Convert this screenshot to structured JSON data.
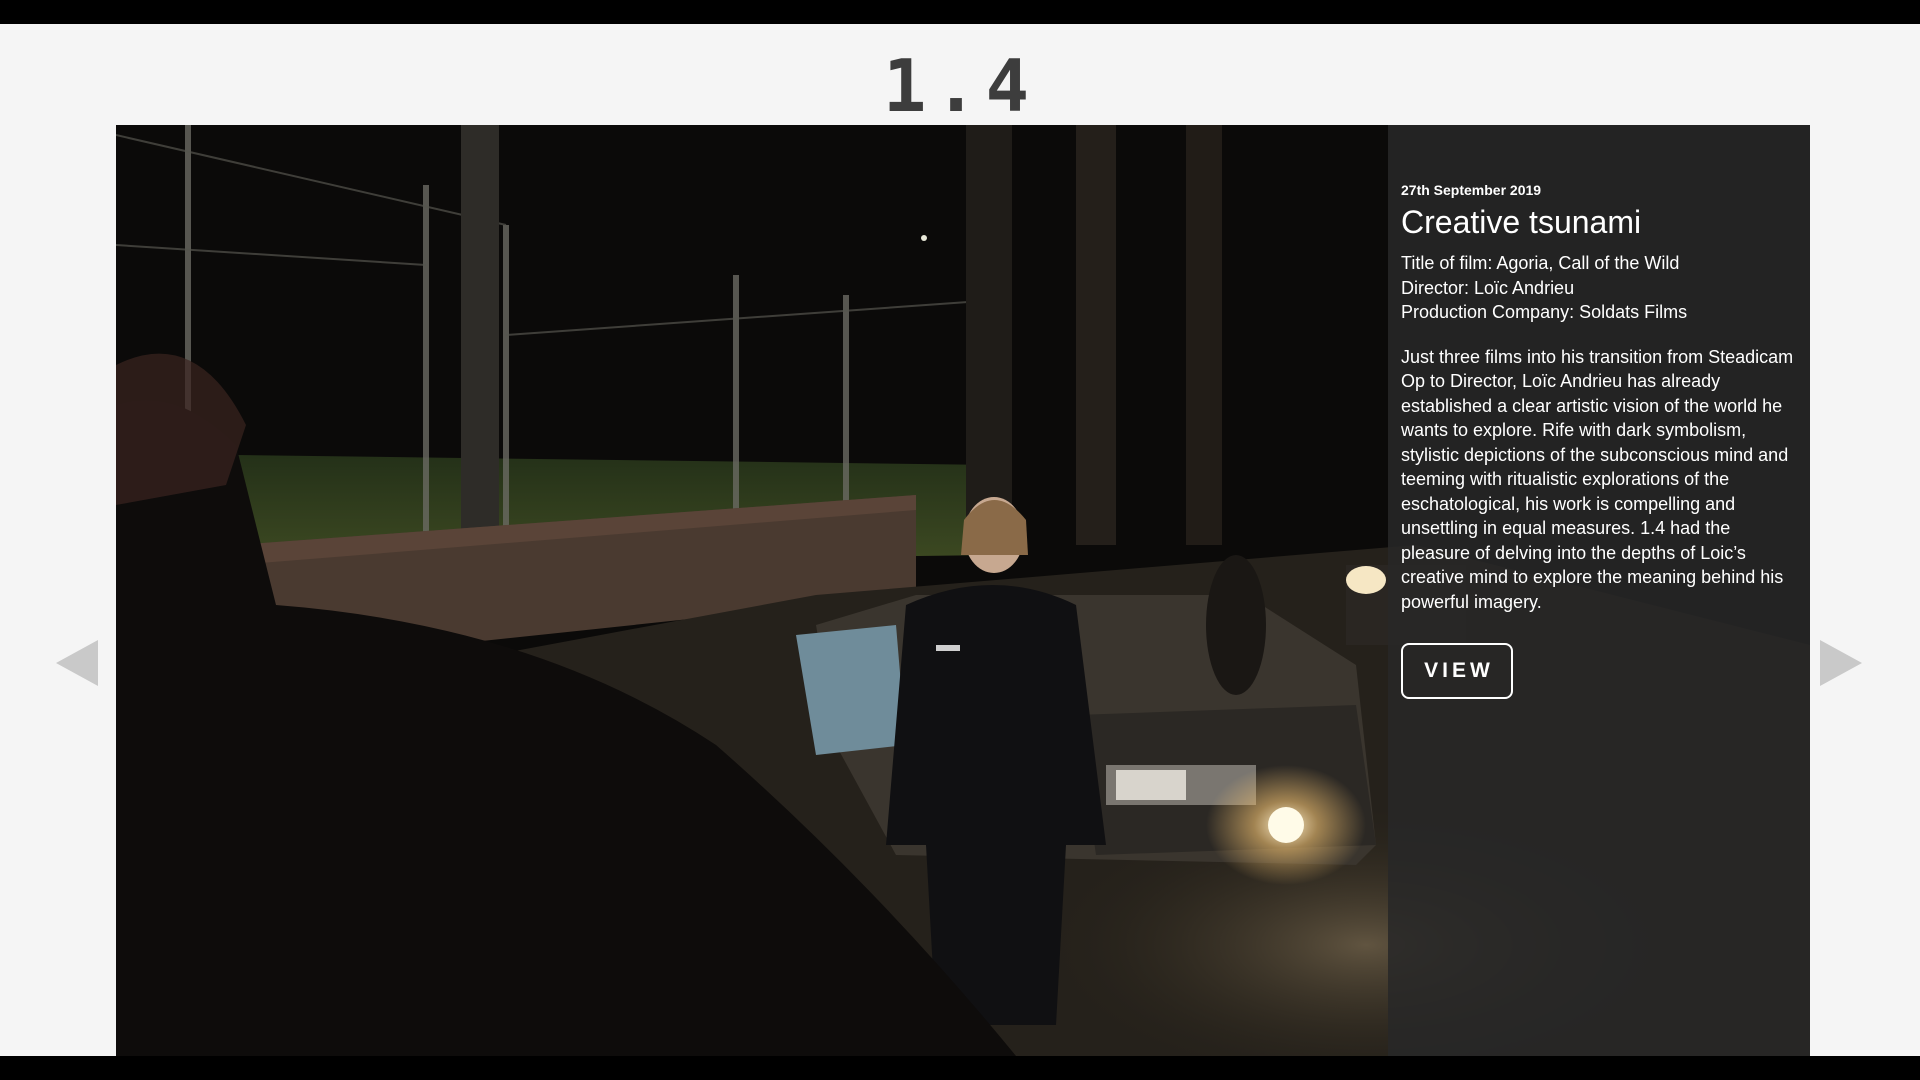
{
  "brand": {
    "logo_text": "1.4"
  },
  "article": {
    "date": "27th September 2019",
    "title": "Creative tsunami",
    "credits": [
      "Title of film: Agoria, Call of the Wild",
      "Director: Loïc Andrieu",
      "Production Company: Soldats Films"
    ],
    "description": "Just three films into his transition from Steadicam Op to Director, Loïc Andrieu has already established a clear artistic vision of the world he wants to explore. Rife with dark symbolism, stylistic depictions of the subconscious mind and teeming with ritualistic explorations of the eschatological, his work is compelling and unsettling in equal measures. 1.4 had the pleasure of delving into the depths of Loic’s creative mind to explore the meaning behind his powerful imagery.",
    "view_label": "VIEW"
  },
  "navigation": {
    "prev_icon": "triangle-left",
    "next_icon": "triangle-right"
  },
  "colors": {
    "background": "#f5f5f5",
    "logo": "#3d3d3d",
    "panel": "#282828",
    "arrow": "#c9c9c9"
  }
}
